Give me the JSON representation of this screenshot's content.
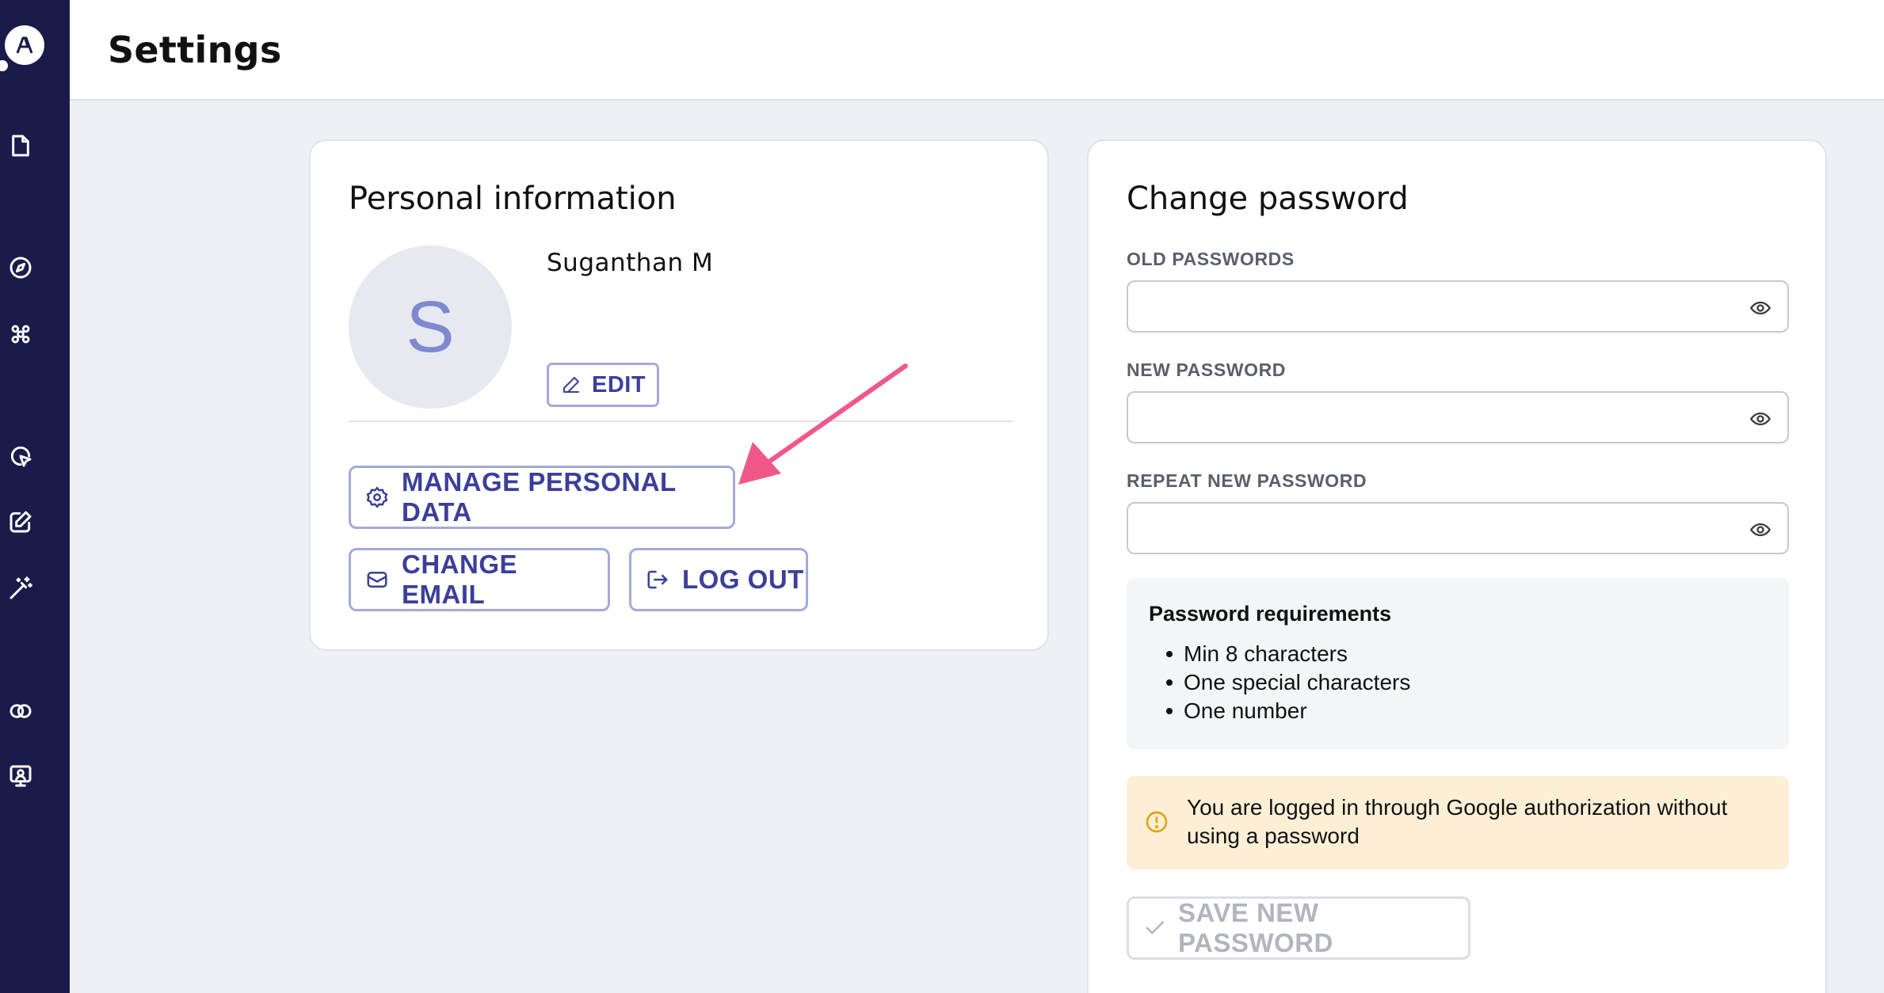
{
  "page": {
    "title": "Settings"
  },
  "sidebar": {
    "logo_alt": "A",
    "items": [
      {
        "icon": "file-icon"
      },
      {
        "icon": "compass-icon"
      },
      {
        "icon": "apps-icon"
      },
      {
        "icon": "cursor-click-icon"
      },
      {
        "icon": "edit-square-icon"
      },
      {
        "icon": "magic-wand-icon"
      },
      {
        "icon": "link-circles-icon"
      },
      {
        "icon": "monitor-user-icon"
      }
    ]
  },
  "personal_info": {
    "title": "Personal information",
    "avatar_initial": "S",
    "name": "Suganthan M",
    "edit_label": "EDIT",
    "manage_label": "MANAGE PERSONAL DATA",
    "change_email_label": "CHANGE EMAIL",
    "logout_label": "LOG OUT"
  },
  "change_password": {
    "title": "Change password",
    "old_label": "OLD PASSWORDS",
    "new_label": "NEW PASSWORD",
    "repeat_label": "REPEAT NEW PASSWORD",
    "old_value": "",
    "new_value": "",
    "repeat_value": "",
    "requirements_title": "Password requirements",
    "requirements": [
      "Min 8 characters",
      "One special characters",
      "One number"
    ],
    "warning": "You are logged in through Google authorization without using a password",
    "save_label": "SAVE NEW PASSWORD"
  },
  "colors": {
    "sidebar": "#1a1b4b",
    "accent": "#3b3f9a",
    "annotation_arrow": "#f0588a",
    "warning_bg": "#fdefd6"
  }
}
